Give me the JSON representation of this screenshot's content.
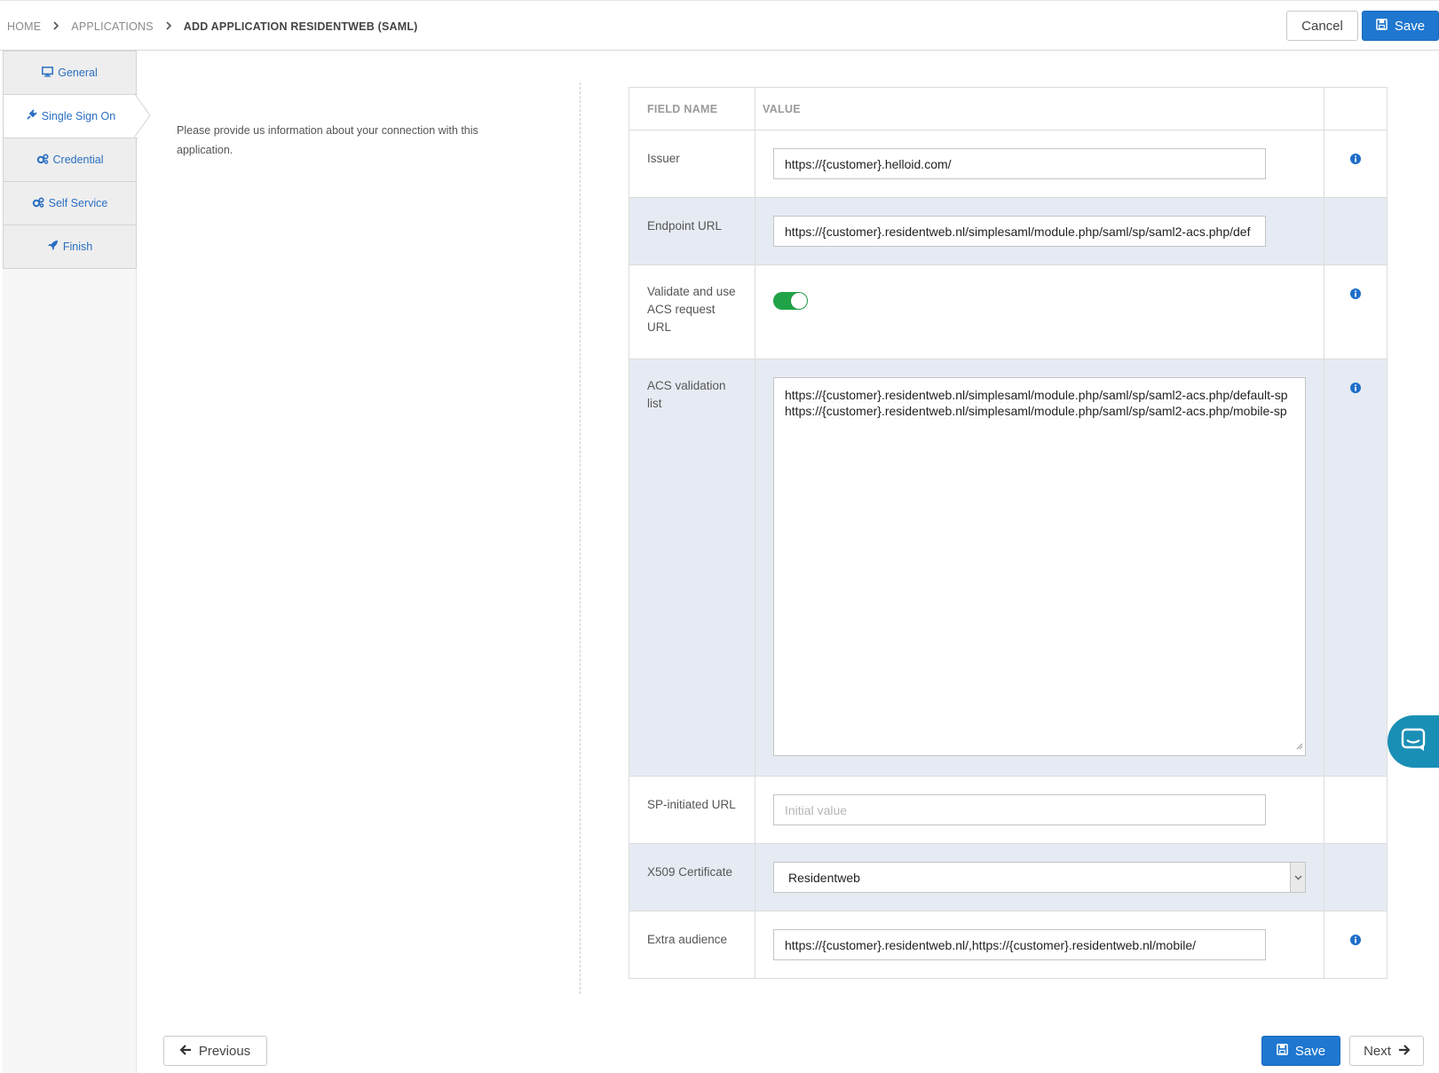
{
  "breadcrumb": {
    "items": [
      "HOME",
      "APPLICATIONS",
      "ADD APPLICATION RESIDENTWEB (SAML)"
    ]
  },
  "header": {
    "cancel_label": "Cancel",
    "save_label": "Save"
  },
  "steps": [
    {
      "label": "General",
      "icon": "monitor-icon"
    },
    {
      "label": "Single Sign On",
      "icon": "plug-icon",
      "active": true
    },
    {
      "label": "Credential",
      "icon": "gears-icon"
    },
    {
      "label": "Self Service",
      "icon": "gears-icon"
    },
    {
      "label": "Finish",
      "icon": "rocket-icon"
    }
  ],
  "intro": {
    "text": "Please provide us information about your connection with this application."
  },
  "table": {
    "headers": {
      "field_name": "FIELD NAME",
      "value": "VALUE"
    },
    "rows": {
      "issuer": {
        "label": "Issuer",
        "value": "https://{customer}.helloid.com/"
      },
      "endpoint_url": {
        "label": "Endpoint URL",
        "value": "https://{customer}.residentweb.nl/simplesaml/module.php/saml/sp/saml2-acs.php/def"
      },
      "validate_acs": {
        "label": "Validate and use ACS request URL",
        "enabled": true
      },
      "acs_list": {
        "label": "ACS validation list",
        "lines": [
          "https://{customer}.residentweb.nl/simplesaml/module.php/saml/sp/saml2-acs.php/default-sp",
          "https://{customer}.residentweb.nl/simplesaml/module.php/saml/sp/saml2-acs.php/mobile-sp"
        ]
      },
      "sp_initiated": {
        "label": "SP-initiated URL",
        "value": "",
        "placeholder": "Initial value"
      },
      "x509": {
        "label": "X509 Certificate",
        "selected": "Residentweb"
      },
      "extra_audience": {
        "label": "Extra audience",
        "value": "https://{customer}.residentweb.nl/,https://{customer}.residentweb.nl/mobile/"
      }
    }
  },
  "footer": {
    "previous_label": "Previous",
    "save_label": "Save",
    "next_label": "Next"
  },
  "colors": {
    "primary": "#1f77d0",
    "step_link": "#2a6fc2",
    "toggle_on": "#20a347",
    "row_alt": "#e6ebf3",
    "chat": "#1a8fb5",
    "info_icon": "#1f6fc9"
  }
}
